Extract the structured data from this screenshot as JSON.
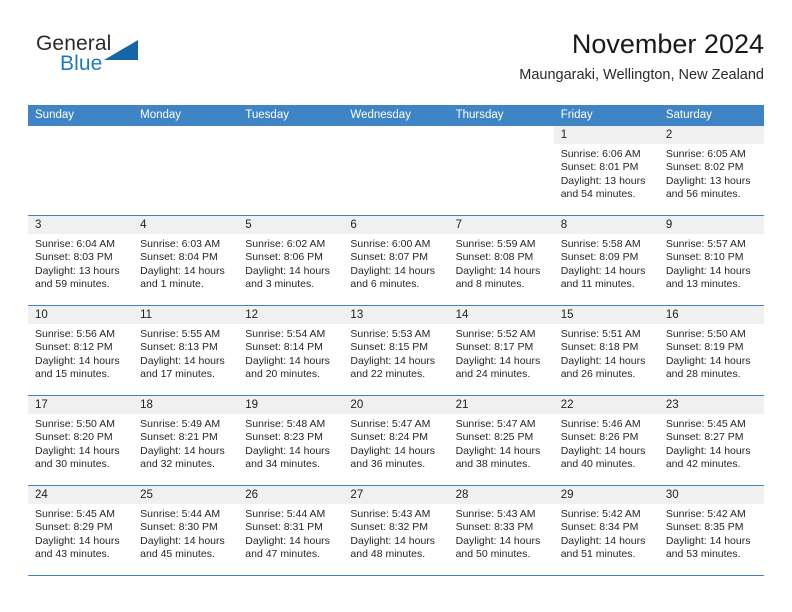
{
  "brand": {
    "word_top": "General",
    "word_bottom": "Blue",
    "triangle_color": "#1565a8",
    "blue_text_color": "#1f7bc1"
  },
  "header": {
    "title": "November 2024",
    "subtitle": "Maungaraki, Wellington, New Zealand",
    "header_bg_color": "#3f84c4",
    "datenum_bg_color": "#f0f0f0"
  },
  "weekdays": [
    "Sunday",
    "Monday",
    "Tuesday",
    "Wednesday",
    "Thursday",
    "Friday",
    "Saturday"
  ],
  "labels": {
    "sunrise_prefix": "Sunrise:",
    "sunset_prefix": "Sunset:",
    "daylight_prefix": "Daylight:"
  },
  "weeks": [
    [
      {
        "day": "",
        "blank": true,
        "line1": "",
        "line2": "",
        "line3": "",
        "line4": ""
      },
      {
        "day": "",
        "blank": true,
        "line1": "",
        "line2": "",
        "line3": "",
        "line4": ""
      },
      {
        "day": "",
        "blank": true,
        "line1": "",
        "line2": "",
        "line3": "",
        "line4": ""
      },
      {
        "day": "",
        "blank": true,
        "line1": "",
        "line2": "",
        "line3": "",
        "line4": ""
      },
      {
        "day": "",
        "blank": true,
        "line1": "",
        "line2": "",
        "line3": "",
        "line4": ""
      },
      {
        "day": "1",
        "line1": "Sunrise: 6:06 AM",
        "line2": "Sunset: 8:01 PM",
        "line3": "Daylight: 13 hours",
        "line4": "and 54 minutes."
      },
      {
        "day": "2",
        "line1": "Sunrise: 6:05 AM",
        "line2": "Sunset: 8:02 PM",
        "line3": "Daylight: 13 hours",
        "line4": "and 56 minutes."
      }
    ],
    [
      {
        "day": "3",
        "line1": "Sunrise: 6:04 AM",
        "line2": "Sunset: 8:03 PM",
        "line3": "Daylight: 13 hours",
        "line4": "and 59 minutes."
      },
      {
        "day": "4",
        "line1": "Sunrise: 6:03 AM",
        "line2": "Sunset: 8:04 PM",
        "line3": "Daylight: 14 hours",
        "line4": "and 1 minute."
      },
      {
        "day": "5",
        "line1": "Sunrise: 6:02 AM",
        "line2": "Sunset: 8:06 PM",
        "line3": "Daylight: 14 hours",
        "line4": "and 3 minutes."
      },
      {
        "day": "6",
        "line1": "Sunrise: 6:00 AM",
        "line2": "Sunset: 8:07 PM",
        "line3": "Daylight: 14 hours",
        "line4": "and 6 minutes."
      },
      {
        "day": "7",
        "line1": "Sunrise: 5:59 AM",
        "line2": "Sunset: 8:08 PM",
        "line3": "Daylight: 14 hours",
        "line4": "and 8 minutes."
      },
      {
        "day": "8",
        "line1": "Sunrise: 5:58 AM",
        "line2": "Sunset: 8:09 PM",
        "line3": "Daylight: 14 hours",
        "line4": "and 11 minutes."
      },
      {
        "day": "9",
        "line1": "Sunrise: 5:57 AM",
        "line2": "Sunset: 8:10 PM",
        "line3": "Daylight: 14 hours",
        "line4": "and 13 minutes."
      }
    ],
    [
      {
        "day": "10",
        "line1": "Sunrise: 5:56 AM",
        "line2": "Sunset: 8:12 PM",
        "line3": "Daylight: 14 hours",
        "line4": "and 15 minutes."
      },
      {
        "day": "11",
        "line1": "Sunrise: 5:55 AM",
        "line2": "Sunset: 8:13 PM",
        "line3": "Daylight: 14 hours",
        "line4": "and 17 minutes."
      },
      {
        "day": "12",
        "line1": "Sunrise: 5:54 AM",
        "line2": "Sunset: 8:14 PM",
        "line3": "Daylight: 14 hours",
        "line4": "and 20 minutes."
      },
      {
        "day": "13",
        "line1": "Sunrise: 5:53 AM",
        "line2": "Sunset: 8:15 PM",
        "line3": "Daylight: 14 hours",
        "line4": "and 22 minutes."
      },
      {
        "day": "14",
        "line1": "Sunrise: 5:52 AM",
        "line2": "Sunset: 8:17 PM",
        "line3": "Daylight: 14 hours",
        "line4": "and 24 minutes."
      },
      {
        "day": "15",
        "line1": "Sunrise: 5:51 AM",
        "line2": "Sunset: 8:18 PM",
        "line3": "Daylight: 14 hours",
        "line4": "and 26 minutes."
      },
      {
        "day": "16",
        "line1": "Sunrise: 5:50 AM",
        "line2": "Sunset: 8:19 PM",
        "line3": "Daylight: 14 hours",
        "line4": "and 28 minutes."
      }
    ],
    [
      {
        "day": "17",
        "line1": "Sunrise: 5:50 AM",
        "line2": "Sunset: 8:20 PM",
        "line3": "Daylight: 14 hours",
        "line4": "and 30 minutes."
      },
      {
        "day": "18",
        "line1": "Sunrise: 5:49 AM",
        "line2": "Sunset: 8:21 PM",
        "line3": "Daylight: 14 hours",
        "line4": "and 32 minutes."
      },
      {
        "day": "19",
        "line1": "Sunrise: 5:48 AM",
        "line2": "Sunset: 8:23 PM",
        "line3": "Daylight: 14 hours",
        "line4": "and 34 minutes."
      },
      {
        "day": "20",
        "line1": "Sunrise: 5:47 AM",
        "line2": "Sunset: 8:24 PM",
        "line3": "Daylight: 14 hours",
        "line4": "and 36 minutes."
      },
      {
        "day": "21",
        "line1": "Sunrise: 5:47 AM",
        "line2": "Sunset: 8:25 PM",
        "line3": "Daylight: 14 hours",
        "line4": "and 38 minutes."
      },
      {
        "day": "22",
        "line1": "Sunrise: 5:46 AM",
        "line2": "Sunset: 8:26 PM",
        "line3": "Daylight: 14 hours",
        "line4": "and 40 minutes."
      },
      {
        "day": "23",
        "line1": "Sunrise: 5:45 AM",
        "line2": "Sunset: 8:27 PM",
        "line3": "Daylight: 14 hours",
        "line4": "and 42 minutes."
      }
    ],
    [
      {
        "day": "24",
        "line1": "Sunrise: 5:45 AM",
        "line2": "Sunset: 8:29 PM",
        "line3": "Daylight: 14 hours",
        "line4": "and 43 minutes."
      },
      {
        "day": "25",
        "line1": "Sunrise: 5:44 AM",
        "line2": "Sunset: 8:30 PM",
        "line3": "Daylight: 14 hours",
        "line4": "and 45 minutes."
      },
      {
        "day": "26",
        "line1": "Sunrise: 5:44 AM",
        "line2": "Sunset: 8:31 PM",
        "line3": "Daylight: 14 hours",
        "line4": "and 47 minutes."
      },
      {
        "day": "27",
        "line1": "Sunrise: 5:43 AM",
        "line2": "Sunset: 8:32 PM",
        "line3": "Daylight: 14 hours",
        "line4": "and 48 minutes."
      },
      {
        "day": "28",
        "line1": "Sunrise: 5:43 AM",
        "line2": "Sunset: 8:33 PM",
        "line3": "Daylight: 14 hours",
        "line4": "and 50 minutes."
      },
      {
        "day": "29",
        "line1": "Sunrise: 5:42 AM",
        "line2": "Sunset: 8:34 PM",
        "line3": "Daylight: 14 hours",
        "line4": "and 51 minutes."
      },
      {
        "day": "30",
        "line1": "Sunrise: 5:42 AM",
        "line2": "Sunset: 8:35 PM",
        "line3": "Daylight: 14 hours",
        "line4": "and 53 minutes."
      }
    ]
  ]
}
